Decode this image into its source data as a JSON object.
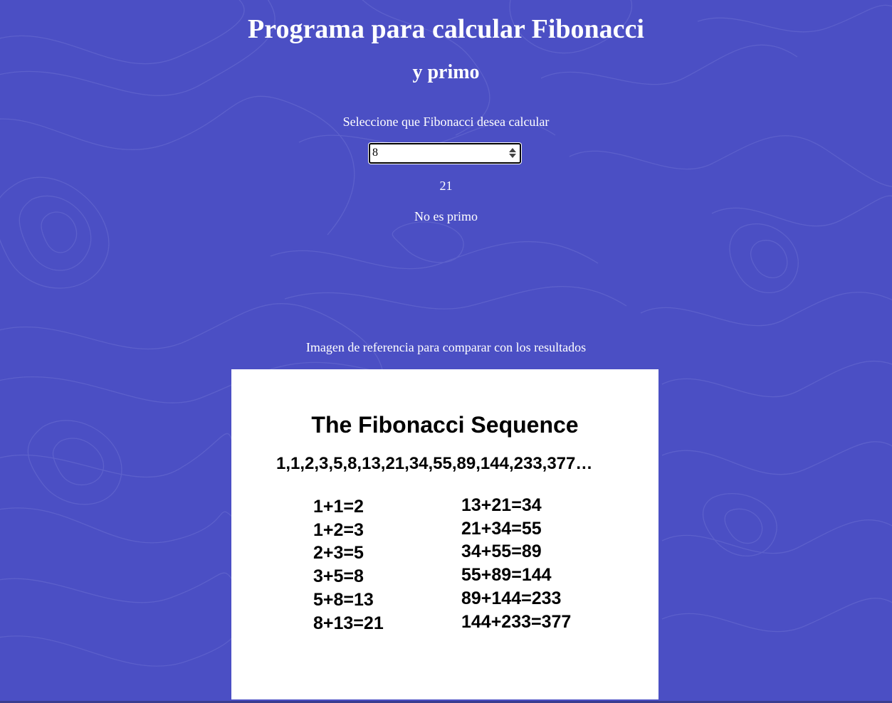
{
  "page": {
    "title": "Programa para calcular Fibonacci",
    "subtitle": "y primo",
    "prompt": "Seleccione que Fibonacci desea calcular",
    "input": {
      "value": "8"
    },
    "result": "21",
    "prime_status": "No es primo",
    "reference_caption": "Imagen de referencia para comparar con los resultados"
  },
  "reference_image": {
    "title": "The Fibonacci Sequence",
    "sequence": "1,1,2,3,5,8,13,21,34,55,89,144,233,377…",
    "left_sums": [
      "1+1=2",
      "1+2=3",
      "2+3=5",
      "3+5=8",
      "5+8=13",
      "8+13=21"
    ],
    "right_sums": [
      "13+21=34",
      "21+34=55",
      "34+55=89",
      "55+89=144",
      "89+144=233",
      "144+233=377"
    ]
  },
  "colors": {
    "background": "#4b4fc4",
    "text": "#ffffff",
    "reference_background": "#ffffff"
  }
}
